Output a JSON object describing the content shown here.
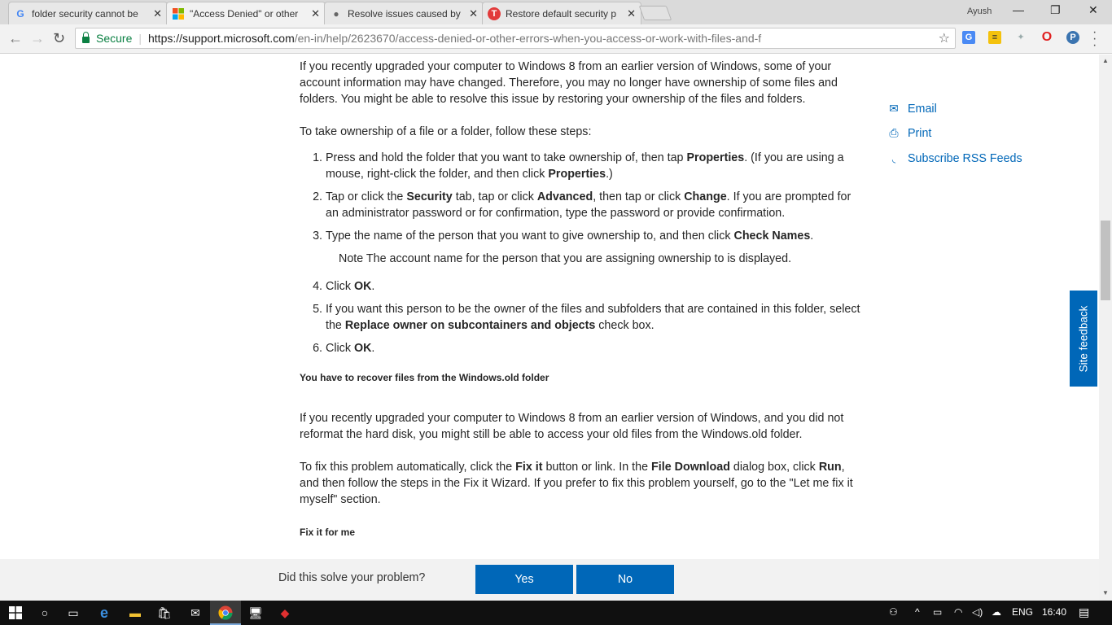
{
  "browser": {
    "tabs": [
      {
        "title": "folder security cannot be",
        "favicon": "google-g-icon",
        "active": false
      },
      {
        "title": "\"Access Denied\" or other",
        "favicon": "microsoft-logo-icon",
        "active": true
      },
      {
        "title": "Resolve issues caused by",
        "favicon": "apple-logo-icon",
        "active": false
      },
      {
        "title": "Restore default security p",
        "favicon": "t-logo-icon",
        "active": false
      }
    ],
    "user": "Ayush",
    "window_controls": {
      "minimize": "—",
      "restore": "❐",
      "close": "✕"
    },
    "secure_label": "Secure",
    "url_host": "https://support.microsoft.com",
    "url_path": "/en-in/help/2623670/access-denied-or-other-errors-when-you-access-or-work-with-files-and-f"
  },
  "article": {
    "para1": "If you recently upgraded your computer to Windows 8 from an earlier version of Windows, some of your account information may have changed. Therefore, you may no longer have ownership of some files and folders. You might be able to resolve this issue by restoring your ownership of the files and folders.",
    "para2": "To take ownership of a file or a folder, follow these steps:",
    "step1": {
      "a": "Press and hold the folder that you want to take ownership of, then tap ",
      "b": "Properties",
      "c": ". (If you are using a mouse, right-click the folder, and then click ",
      "d": "Properties",
      "e": ".)"
    },
    "step2": {
      "a": "Tap or click the ",
      "b": "Security",
      "c": " tab, tap or click ",
      "d": "Advanced",
      "e": ", then tap or click ",
      "f": "Change",
      "g": ". If you are prompted for an administrator password or for confirmation, type the password or provide confirmation."
    },
    "step3": {
      "a": "Type the name of the person that you want to give ownership to, and then click ",
      "b": "Check Names",
      "c": "."
    },
    "note": "Note The account name for the person that you are assigning ownership to is displayed.",
    "step4": {
      "a": "Click ",
      "b": "OK",
      "c": "."
    },
    "step5": {
      "a": "If you want this person to be the owner of the files and subfolders that are contained in this folder, select the ",
      "b": "Replace owner on subcontainers and objects",
      "c": " check box."
    },
    "step6": {
      "a": "Click ",
      "b": "OK",
      "c": "."
    },
    "heading2": "You have to recover files from the Windows.old folder",
    "para3": "If you recently upgraded your computer to Windows 8 from an earlier version of Windows, and you did not reformat the hard disk, you might still be able to access your old files from the Windows.old folder.",
    "para4": {
      "a": "To fix this problem automatically, click the ",
      "b": "Fix it",
      "c": " button or link. In the ",
      "d": "File Download",
      "e": " dialog box, click ",
      "f": "Run",
      "g": ", and then follow the steps in the Fix it Wizard. If you prefer to fix this problem yourself, go to the \"Let me fix it myself\" section."
    },
    "heading3": "Fix it for me"
  },
  "sidebar": {
    "email": "Email",
    "print": "Print",
    "rss": "Subscribe RSS Feeds"
  },
  "feedback": "Site feedback",
  "solve": {
    "question": "Did this solve your problem?",
    "yes": "Yes",
    "no": "No"
  },
  "taskbar": {
    "language": "ENG",
    "time": "16:40"
  },
  "colors": {
    "link": "#0067b8",
    "secure": "#0b8043",
    "taskbar": "#101010"
  }
}
